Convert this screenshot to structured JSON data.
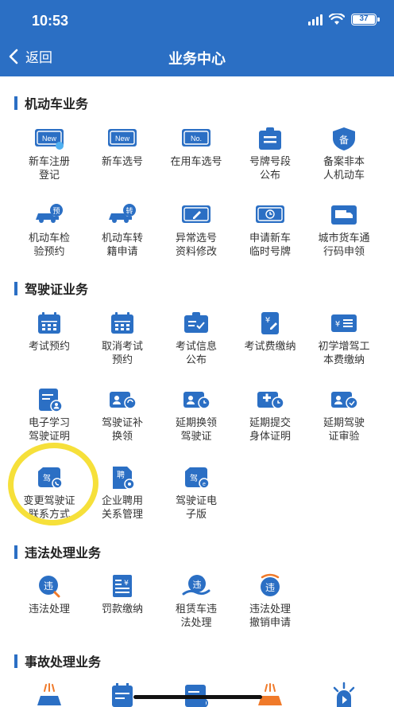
{
  "status": {
    "time": "10:53",
    "battery": "37"
  },
  "nav": {
    "back_label": "返回",
    "title": "业务中心"
  },
  "sections": {
    "motor": {
      "title": "机动车业务",
      "items": [
        "新车注册\n登记",
        "新车选号",
        "在用车选号",
        "号牌号段\n公布",
        "备案非本\n人机动车",
        "机动车检\n验预约",
        "机动车转\n籍申请",
        "异常选号\n资料修改",
        "申请新车\n临时号牌",
        "城市货车通\n行码申领"
      ],
      "icon_text": {
        "new1": "New",
        "new2": "New",
        "no": "No.",
        "bei": "备",
        "yu": "预",
        "zhuan": "转"
      }
    },
    "license": {
      "title": "驾驶证业务",
      "items": [
        "考试预约",
        "取消考试\n预约",
        "考试信息\n公布",
        "考试费缴纳",
        "初学增驾工\n本费缴纳",
        "电子学习\n驾驶证明",
        "驾驶证补\n换领",
        "延期换领\n驾驶证",
        "延期提交\n身体证明",
        "延期驾驶\n证审验",
        "变更驾驶证\n联系方式",
        "企业聘用\n关系管理",
        "驾驶证电\n子版"
      ],
      "icon_text": {
        "jia": "驾",
        "pin": "聘"
      }
    },
    "violation": {
      "title": "违法处理业务",
      "items": [
        "违法处理",
        "罚款缴纳",
        "租赁车违\n法处理",
        "违法处理\n撤销申请"
      ],
      "icon_text": {
        "wei": "违"
      }
    },
    "accident": {
      "title": "事故处理业务"
    }
  },
  "colors": {
    "header": "#2b6fc4",
    "icon_blue": "#2b6fc4",
    "accent_orange": "#f07a2a",
    "highlight_circle": "#f6e03a"
  }
}
